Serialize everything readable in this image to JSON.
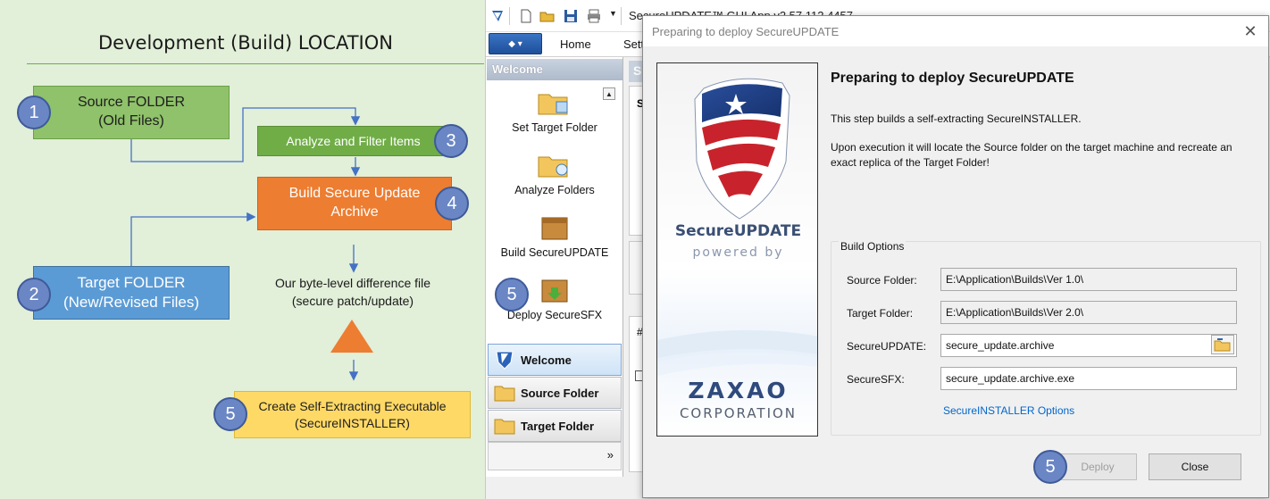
{
  "diagram": {
    "title": "Development (Build) LOCATION",
    "source_box": {
      "line1": "Source FOLDER",
      "line2": "(Old Files)",
      "badge": "1"
    },
    "target_box": {
      "line1": "Target FOLDER",
      "line2": "(New/Revised Files)",
      "badge": "2"
    },
    "analyze_box": {
      "label": "Analyze and Filter Items",
      "badge": "3"
    },
    "build_box": {
      "line1": "Build Secure Update",
      "line2": "Archive",
      "badge": "4"
    },
    "diff_text": {
      "line1": "Our byte-level difference file",
      "line2": "(secure patch/update)"
    },
    "create_box": {
      "line1": "Create Self-Extracting Executable",
      "line2": "(SecureINSTALLER)",
      "badge": "5"
    },
    "colors": {
      "green_light": "#8fc26a",
      "green": "#70ad47",
      "orange": "#ed7d31",
      "blue": "#5b9bd5",
      "yellow": "#ffd966",
      "badge": "#6a86c4"
    }
  },
  "app": {
    "window_title": "SecureUPDATE™ GUI App v2.57.112.4457",
    "ribbon_tabs": [
      "Home",
      "Sett"
    ],
    "nav": {
      "header": "Welcome",
      "buttons": [
        {
          "label": "Set Target Folder",
          "icon": "folder-cube-icon"
        },
        {
          "label": "Analyze Folders",
          "icon": "folder-analyze-icon"
        },
        {
          "label": "Build SecureUPDATE",
          "icon": "box-icon"
        },
        {
          "label": "Deploy SecureSFX",
          "icon": "box-deploy-icon",
          "badge": "5"
        }
      ],
      "panes": [
        {
          "label": "Welcome",
          "icon": "shield-icon",
          "active": true
        },
        {
          "label": "Source Folder",
          "icon": "folder-icon"
        },
        {
          "label": "Target Folder",
          "icon": "folder-icon"
        }
      ],
      "more": "»"
    },
    "content_peek": {
      "strip": "S",
      "row_label": "S",
      "hash": "#"
    }
  },
  "dialog": {
    "title": "Preparing to deploy SecureUPDATE",
    "close_glyph": "✕",
    "heading": "Preparing to deploy SecureUPDATE",
    "text1": "This step builds a self-extracting SecureINSTALLER.",
    "text2": "Upon execution it will locate the Source folder on the target machine and recreate an exact replica of the Target Folder!",
    "banner": {
      "product_name": "SecureUPDATE",
      "powered_by": "powered by",
      "company": "ZAXAO",
      "company_sub": "CORPORATION"
    },
    "build_options": {
      "title": "Build Options",
      "fields": [
        {
          "label": "Source Folder:",
          "value": "E:\\Application\\Builds\\Ver 1.0\\",
          "readonly": true
        },
        {
          "label": "Target Folder:",
          "value": "E:\\Application\\Builds\\Ver 2.0\\",
          "readonly": true
        },
        {
          "label": "SecureUPDATE:",
          "value": "secure_update.archive",
          "readonly": false
        },
        {
          "label": "SecureSFX:",
          "value": "secure_update.archive.exe",
          "readonly": false
        }
      ],
      "link": "SecureINSTALLER Options"
    },
    "buttons": {
      "deploy": "Deploy",
      "deploy_badge": "5",
      "close": "Close"
    }
  }
}
